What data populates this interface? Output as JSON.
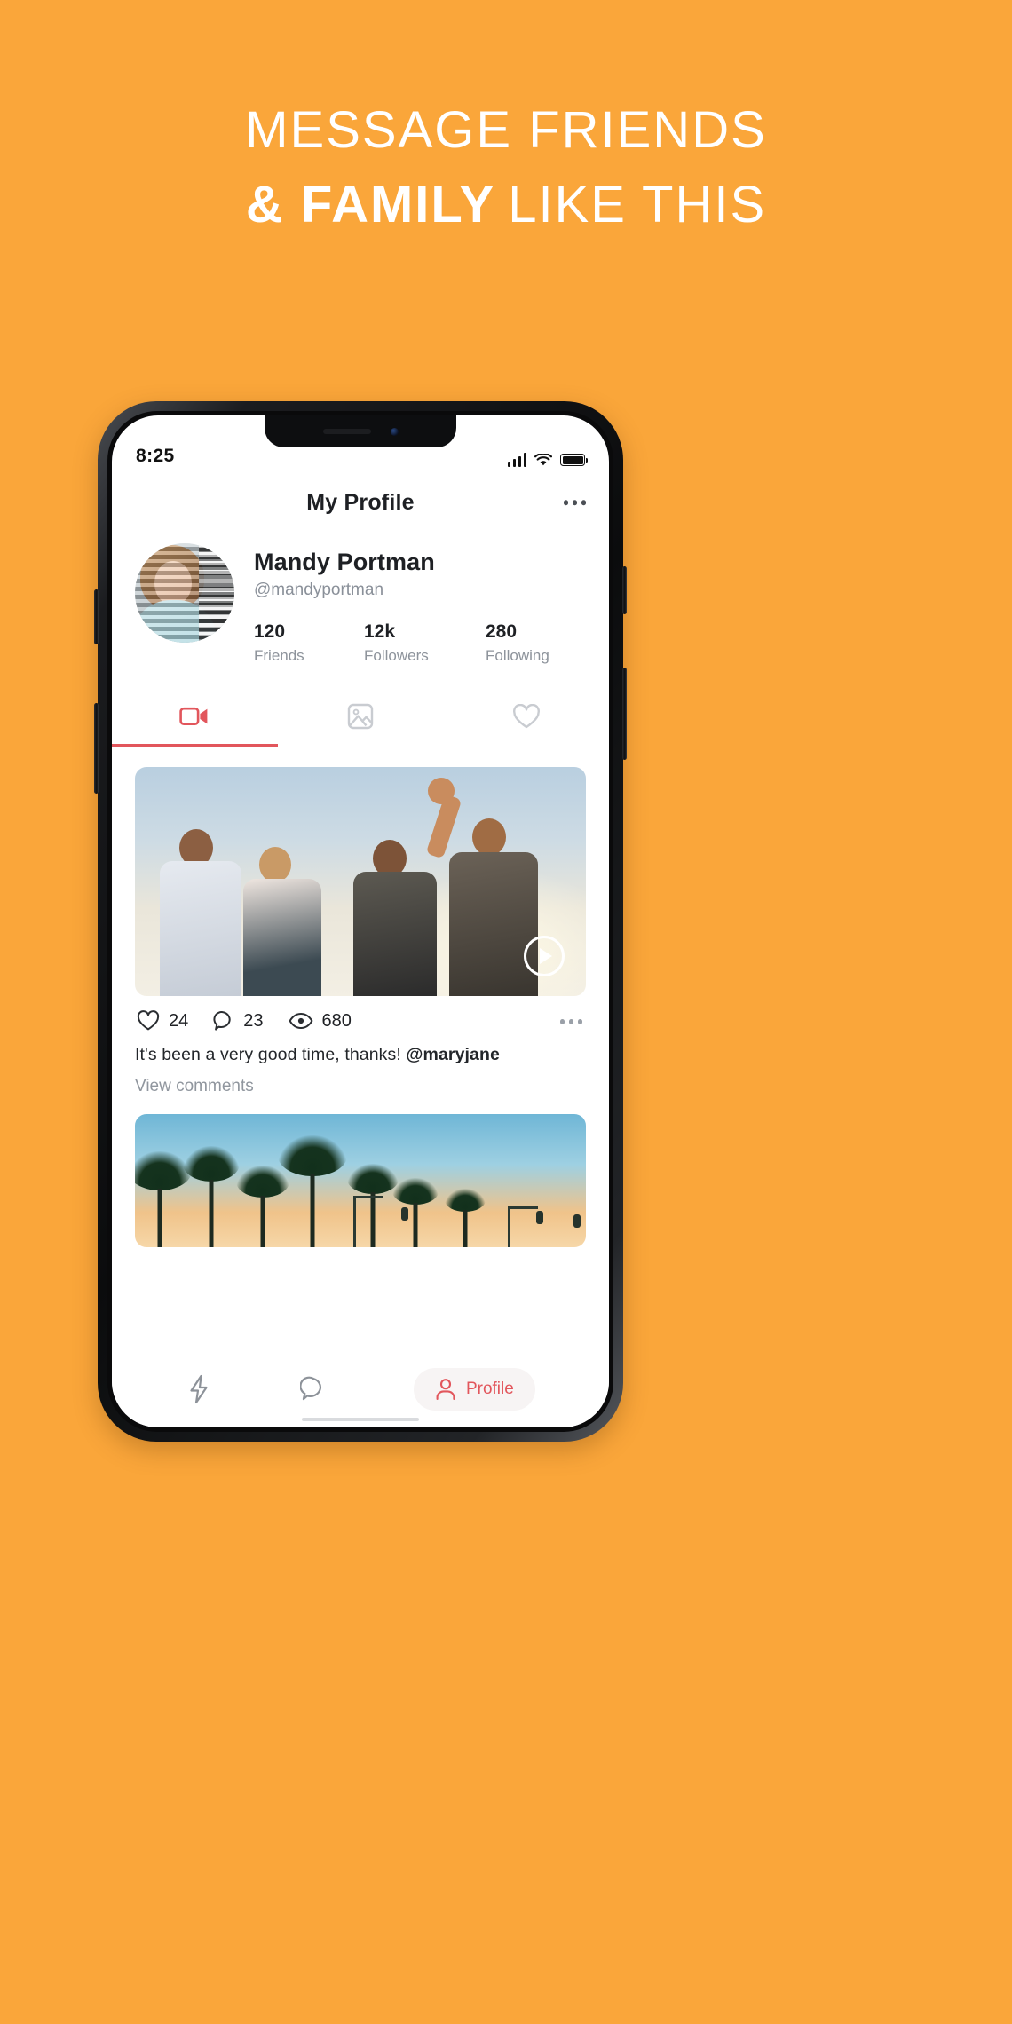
{
  "page": {
    "background_color": "#faa63a",
    "headline": {
      "line1": "MESSAGE FRIENDS",
      "line2_bold": "& FAMILY",
      "line2_light": "LIKE THIS"
    }
  },
  "phone": {
    "status_bar": {
      "time": "8:25",
      "signal_icon": "cellular-bars-icon",
      "wifi_icon": "wifi-icon",
      "battery_icon": "battery-full-icon"
    },
    "header": {
      "title": "My Profile",
      "more_icon": "more-horizontal-icon"
    },
    "profile": {
      "avatar_icon": "user-avatar-photo",
      "name": "Mandy Portman",
      "handle": "@mandyportman",
      "stats": [
        {
          "value": "120",
          "label": "Friends"
        },
        {
          "value": "12k",
          "label": "Followers"
        },
        {
          "value": "280",
          "label": "Following"
        }
      ]
    },
    "tabs": [
      {
        "icon": "video-camera-icon",
        "active": true
      },
      {
        "icon": "image-icon",
        "active": false
      },
      {
        "icon": "heart-icon",
        "active": false
      }
    ],
    "accent_color": "#e2565c",
    "posts": [
      {
        "media_icon": "video-thumbnail",
        "play_icon": "play-circle-icon",
        "engagement": [
          {
            "icon": "heart-icon",
            "value": "24"
          },
          {
            "icon": "comment-bubble-icon",
            "value": "23"
          },
          {
            "icon": "eye-icon",
            "value": "680"
          }
        ],
        "more_icon": "more-horizontal-icon",
        "caption_text": "It's been a very good time, thanks! ",
        "caption_mention": "@maryjane",
        "view_comments": "View comments"
      },
      {
        "media_icon": "palm-trees-photo"
      }
    ],
    "bottom_nav": [
      {
        "icon": "lightning-bolt-icon",
        "label": "",
        "active": false
      },
      {
        "icon": "chat-bubble-icon",
        "label": "",
        "active": false
      },
      {
        "icon": "person-icon",
        "label": "Profile",
        "active": true
      }
    ]
  }
}
